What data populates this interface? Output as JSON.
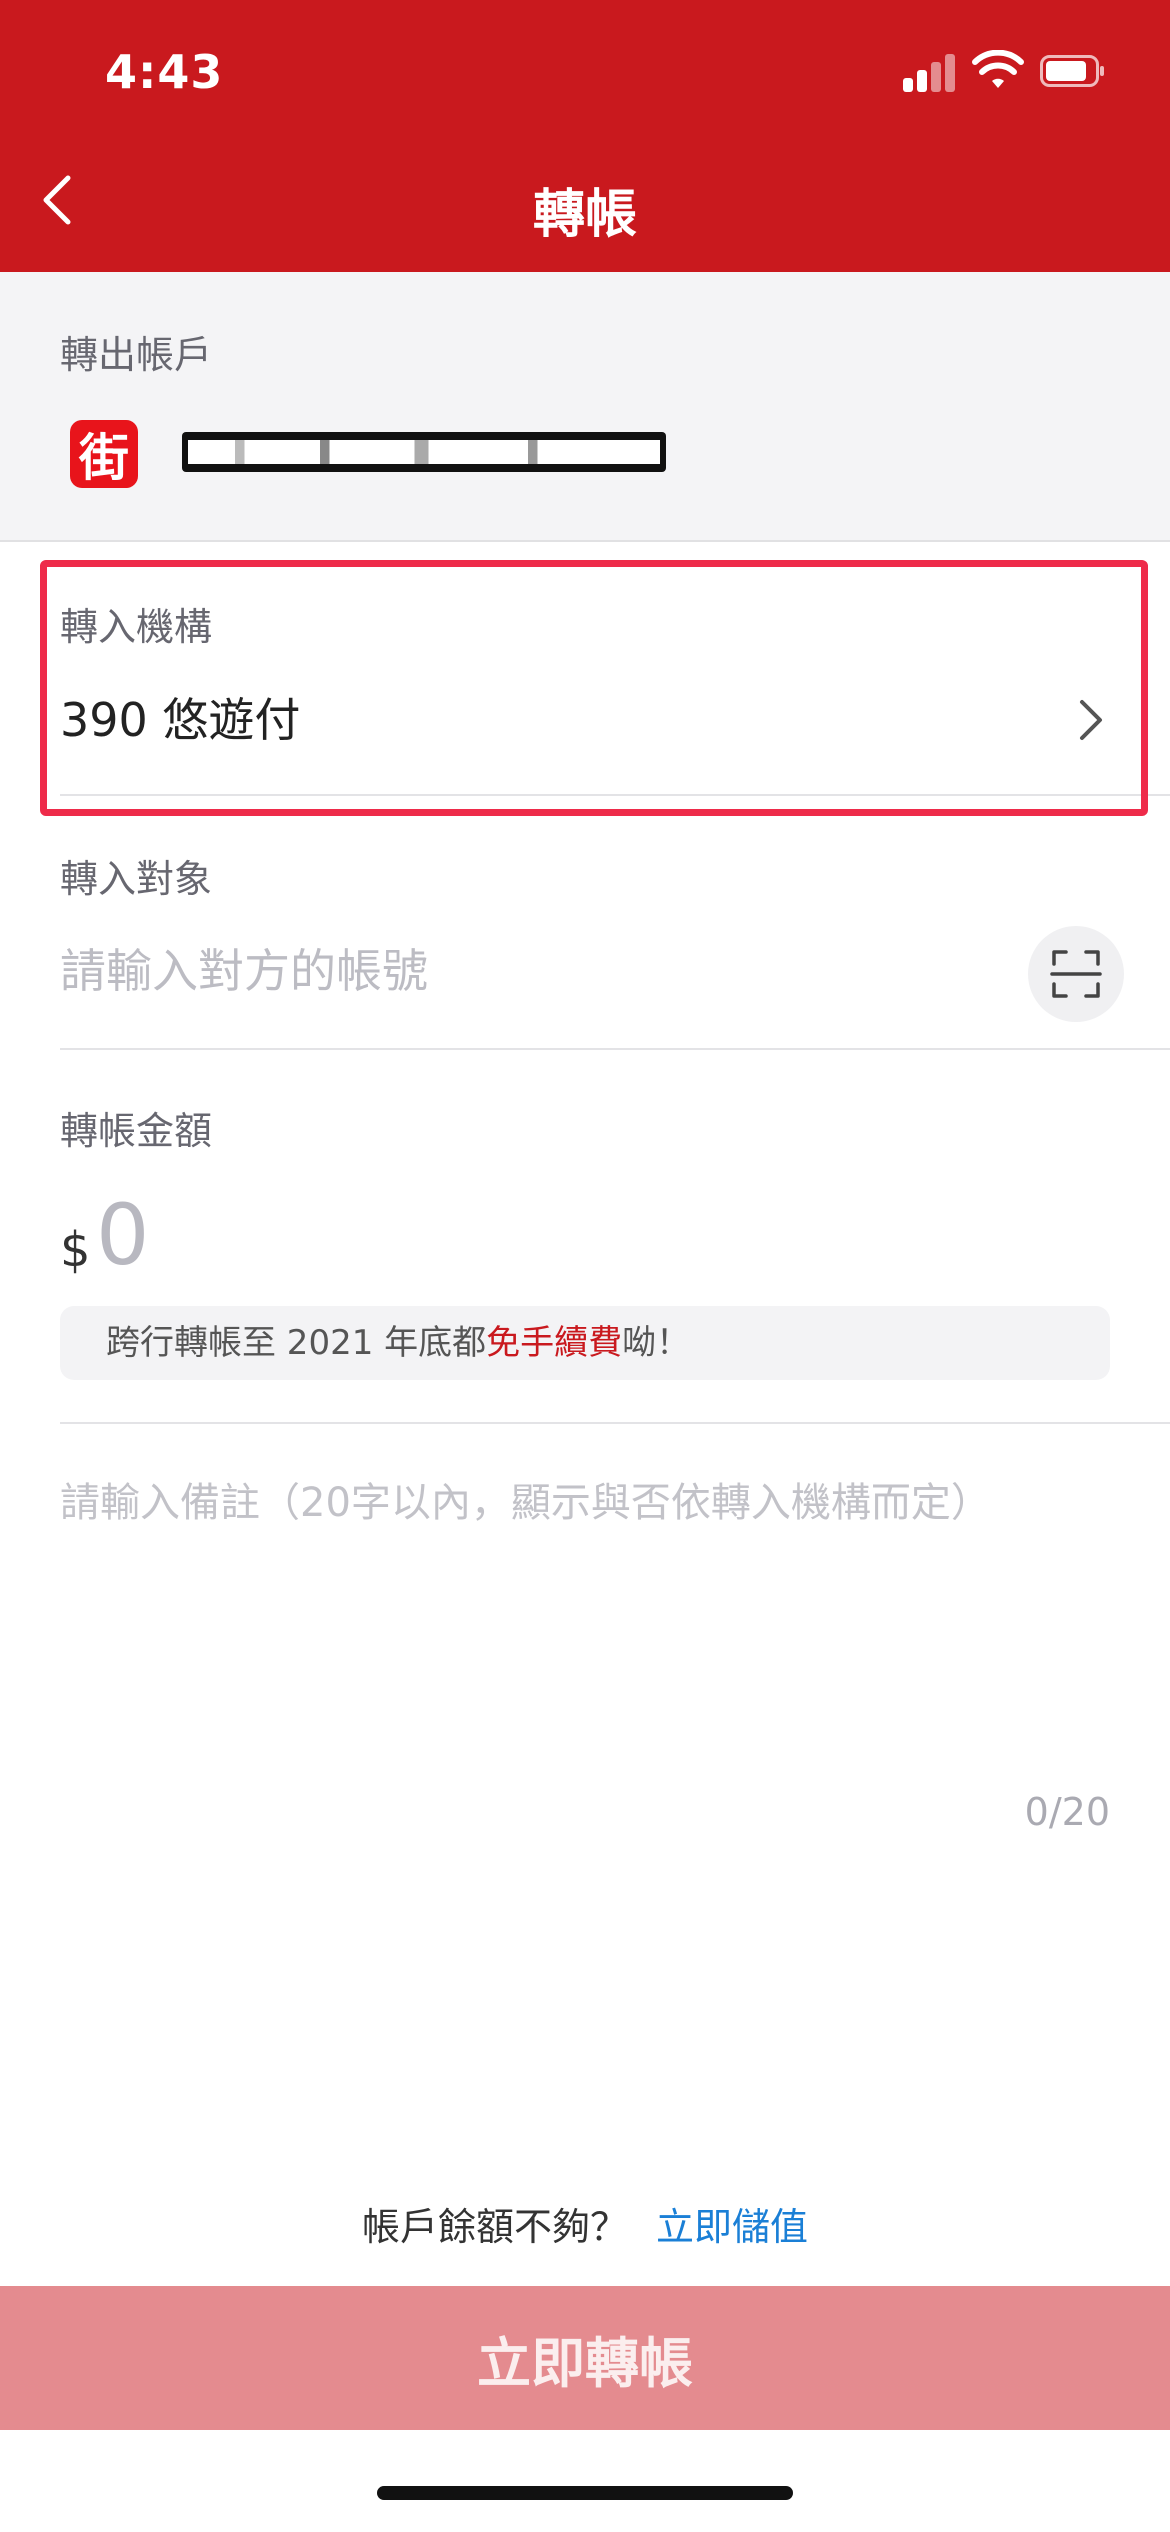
{
  "status_bar": {
    "time": "4:43"
  },
  "header": {
    "title": "轉帳",
    "back_icon": "chevron-left-icon"
  },
  "source_account": {
    "label": "轉出帳戶",
    "logo_text": "街"
  },
  "institution": {
    "label": "轉入機構",
    "value": "390 悠遊付",
    "icon": "chevron-right-icon"
  },
  "recipient": {
    "label": "轉入對象",
    "placeholder": "請輸入對方的帳號",
    "scan_icon": "scan-icon"
  },
  "amount": {
    "label": "轉帳金額",
    "currency": "$",
    "value": "0",
    "promo_before": "跨行轉帳至 2021 年底都",
    "promo_highlight": "免手續費",
    "promo_after": "呦！"
  },
  "memo": {
    "placeholder": "請輸入備註（20字以內，顯示與否依轉入機構而定）",
    "counter": "0/20"
  },
  "footer": {
    "balance_text": "帳戶餘額不夠？",
    "topup_link": "立即儲值",
    "submit_label": "立即轉帳"
  },
  "colors": {
    "brand": "#c9191e",
    "highlight_border": "#ee2b4a",
    "link": "#1a7fd6",
    "submit_disabled": "#e48b8f"
  }
}
